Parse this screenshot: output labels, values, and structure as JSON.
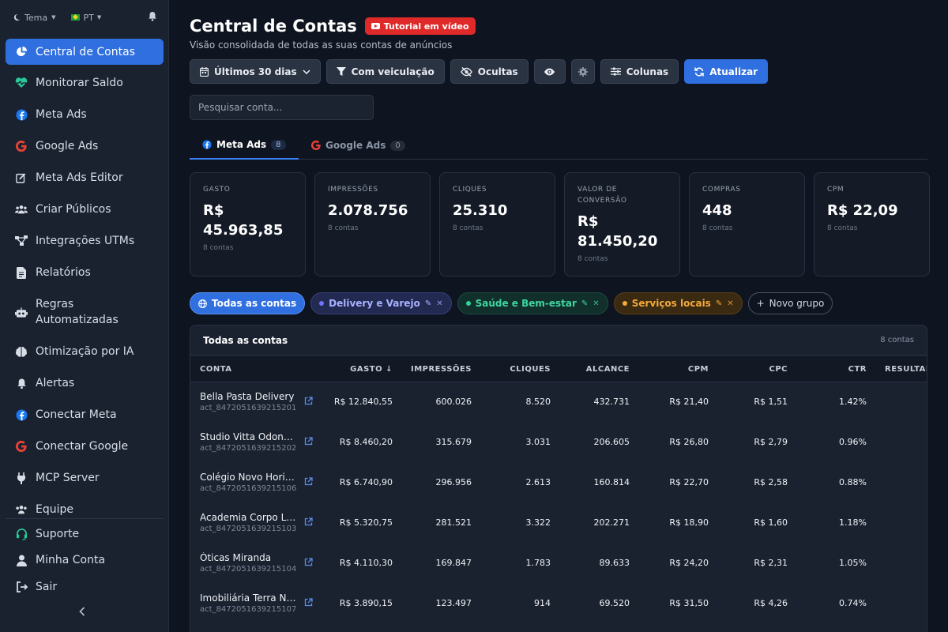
{
  "sidebar": {
    "theme_label": "Tema",
    "lang_label": "PT",
    "items": [
      {
        "label": "Central de Contas",
        "icon": "pie-chart-icon"
      },
      {
        "label": "Monitorar Saldo",
        "icon": "heartbeat-icon"
      },
      {
        "label": "Meta Ads",
        "icon": "facebook-icon"
      },
      {
        "label": "Google Ads",
        "icon": "google-icon"
      },
      {
        "label": "Meta Ads Editor",
        "icon": "edit-icon"
      },
      {
        "label": "Criar Públicos",
        "icon": "users-icon"
      },
      {
        "label": "Integrações UTMs",
        "icon": "network-icon"
      },
      {
        "label": "Relatórios",
        "icon": "file-icon"
      },
      {
        "label": "Regras",
        "label2": "Automatizadas",
        "icon": "robot-icon"
      },
      {
        "label": "Otimização por IA",
        "icon": "brain-icon"
      },
      {
        "label": "Alertas",
        "icon": "bell-icon"
      },
      {
        "label": "Conectar Meta",
        "icon": "facebook-icon"
      },
      {
        "label": "Conectar Google",
        "icon": "google-icon"
      },
      {
        "label": "MCP Server",
        "icon": "plug-icon"
      },
      {
        "label": "Equipe",
        "icon": "team-icon"
      }
    ],
    "footer": [
      {
        "label": "Suporte",
        "icon": "headset-icon"
      },
      {
        "label": "Minha Conta",
        "icon": "user-icon"
      },
      {
        "label": "Sair",
        "icon": "logout-icon"
      }
    ]
  },
  "header": {
    "title": "Central de Contas",
    "tutorial_label": "Tutorial em vídeo",
    "subtitle": "Visão consolidada de todas as suas contas de anúncios"
  },
  "toolbar": {
    "period_label": "Últimos 30 dias",
    "filter_label": "Com veiculação",
    "hidden_label": "Ocultas",
    "columns_label": "Colunas",
    "refresh_label": "Atualizar"
  },
  "search": {
    "placeholder": "Pesquisar conta..."
  },
  "tabs": [
    {
      "label": "Meta Ads",
      "count": "8"
    },
    {
      "label": "Google Ads",
      "count": "0"
    }
  ],
  "stats": [
    {
      "label": "GASTO",
      "value": "R$ 45.963,85",
      "sub": "8 contas"
    },
    {
      "label": "IMPRESSÕES",
      "value": "2.078.756",
      "sub": "8 contas"
    },
    {
      "label": "CLIQUES",
      "value": "25.310",
      "sub": "8 contas"
    },
    {
      "label": "VALOR DE CONVERSÃO",
      "value": "R$ 81.450,20",
      "sub": "8 contas"
    },
    {
      "label": "COMPRAS",
      "value": "448",
      "sub": "8 contas"
    },
    {
      "label": "CPM",
      "value": "R$ 22,09",
      "sub": "8 contas"
    }
  ],
  "groups": {
    "all_label": "Todas as contas",
    "items": [
      {
        "label": "Delivery e Varejo",
        "color": "#6d73ff"
      },
      {
        "label": "Saúde e Bem-estar",
        "color": "#2fd39c"
      },
      {
        "label": "Serviços locais",
        "color": "#f3a93b"
      }
    ],
    "new_label": "Novo grupo"
  },
  "table": {
    "title": "Todas as contas",
    "count": "8 contas",
    "columns": [
      "CONTA",
      "GASTO ↓",
      "IMPRESSÕES",
      "CLIQUES",
      "ALCANCE",
      "CPM",
      "CPC",
      "CTR",
      "RESULTAD"
    ],
    "rows": [
      {
        "name": "Bella Pasta Delivery",
        "id": "act_8472051639215201",
        "gasto": "R$ 12.840,55",
        "impressoes": "600.026",
        "cliques": "8.520",
        "alcance": "432.731",
        "cpm": "R$ 21,40",
        "cpc": "R$ 1,51",
        "ctr": "1.42%"
      },
      {
        "name": "Studio Vitta Odontologia",
        "id": "act_8472051639215202",
        "gasto": "R$ 8.460,20",
        "impressoes": "315.679",
        "cliques": "3.031",
        "alcance": "206.605",
        "cpm": "R$ 26,80",
        "cpc": "R$ 2,79",
        "ctr": "0.96%"
      },
      {
        "name": "Colégio Novo Horizonte",
        "id": "act_8472051639215106",
        "gasto": "R$ 6.740,90",
        "impressoes": "296.956",
        "cliques": "2.613",
        "alcance": "160.814",
        "cpm": "R$ 22,70",
        "cpc": "R$ 2,58",
        "ctr": "0.88%"
      },
      {
        "name": "Academia Corpo Livre",
        "id": "act_8472051639215103",
        "gasto": "R$ 5.320,75",
        "impressoes": "281.521",
        "cliques": "3.322",
        "alcance": "202.271",
        "cpm": "R$ 18,90",
        "cpc": "R$ 1,60",
        "ctr": "1.18%"
      },
      {
        "name": "Óticas Miranda",
        "id": "act_8472051639215104",
        "gasto": "R$ 4.110,30",
        "impressoes": "169.847",
        "cliques": "1.783",
        "alcance": "89.633",
        "cpm": "R$ 24,20",
        "cpc": "R$ 2,31",
        "ctr": "1.05%"
      },
      {
        "name": "Imobiliária Terra Nova",
        "id": "act_8472051639215107",
        "gasto": "R$ 3.890,15",
        "impressoes": "123.497",
        "cliques": "914",
        "alcance": "69.520",
        "cpm": "R$ 31,50",
        "cpc": "R$ 4,26",
        "ctr": "0.74%"
      }
    ]
  },
  "colors": {
    "accent": "#2f6fe0",
    "background": "#0f1520",
    "sidebar": "#1a2230",
    "danger": "#e02a2a"
  }
}
